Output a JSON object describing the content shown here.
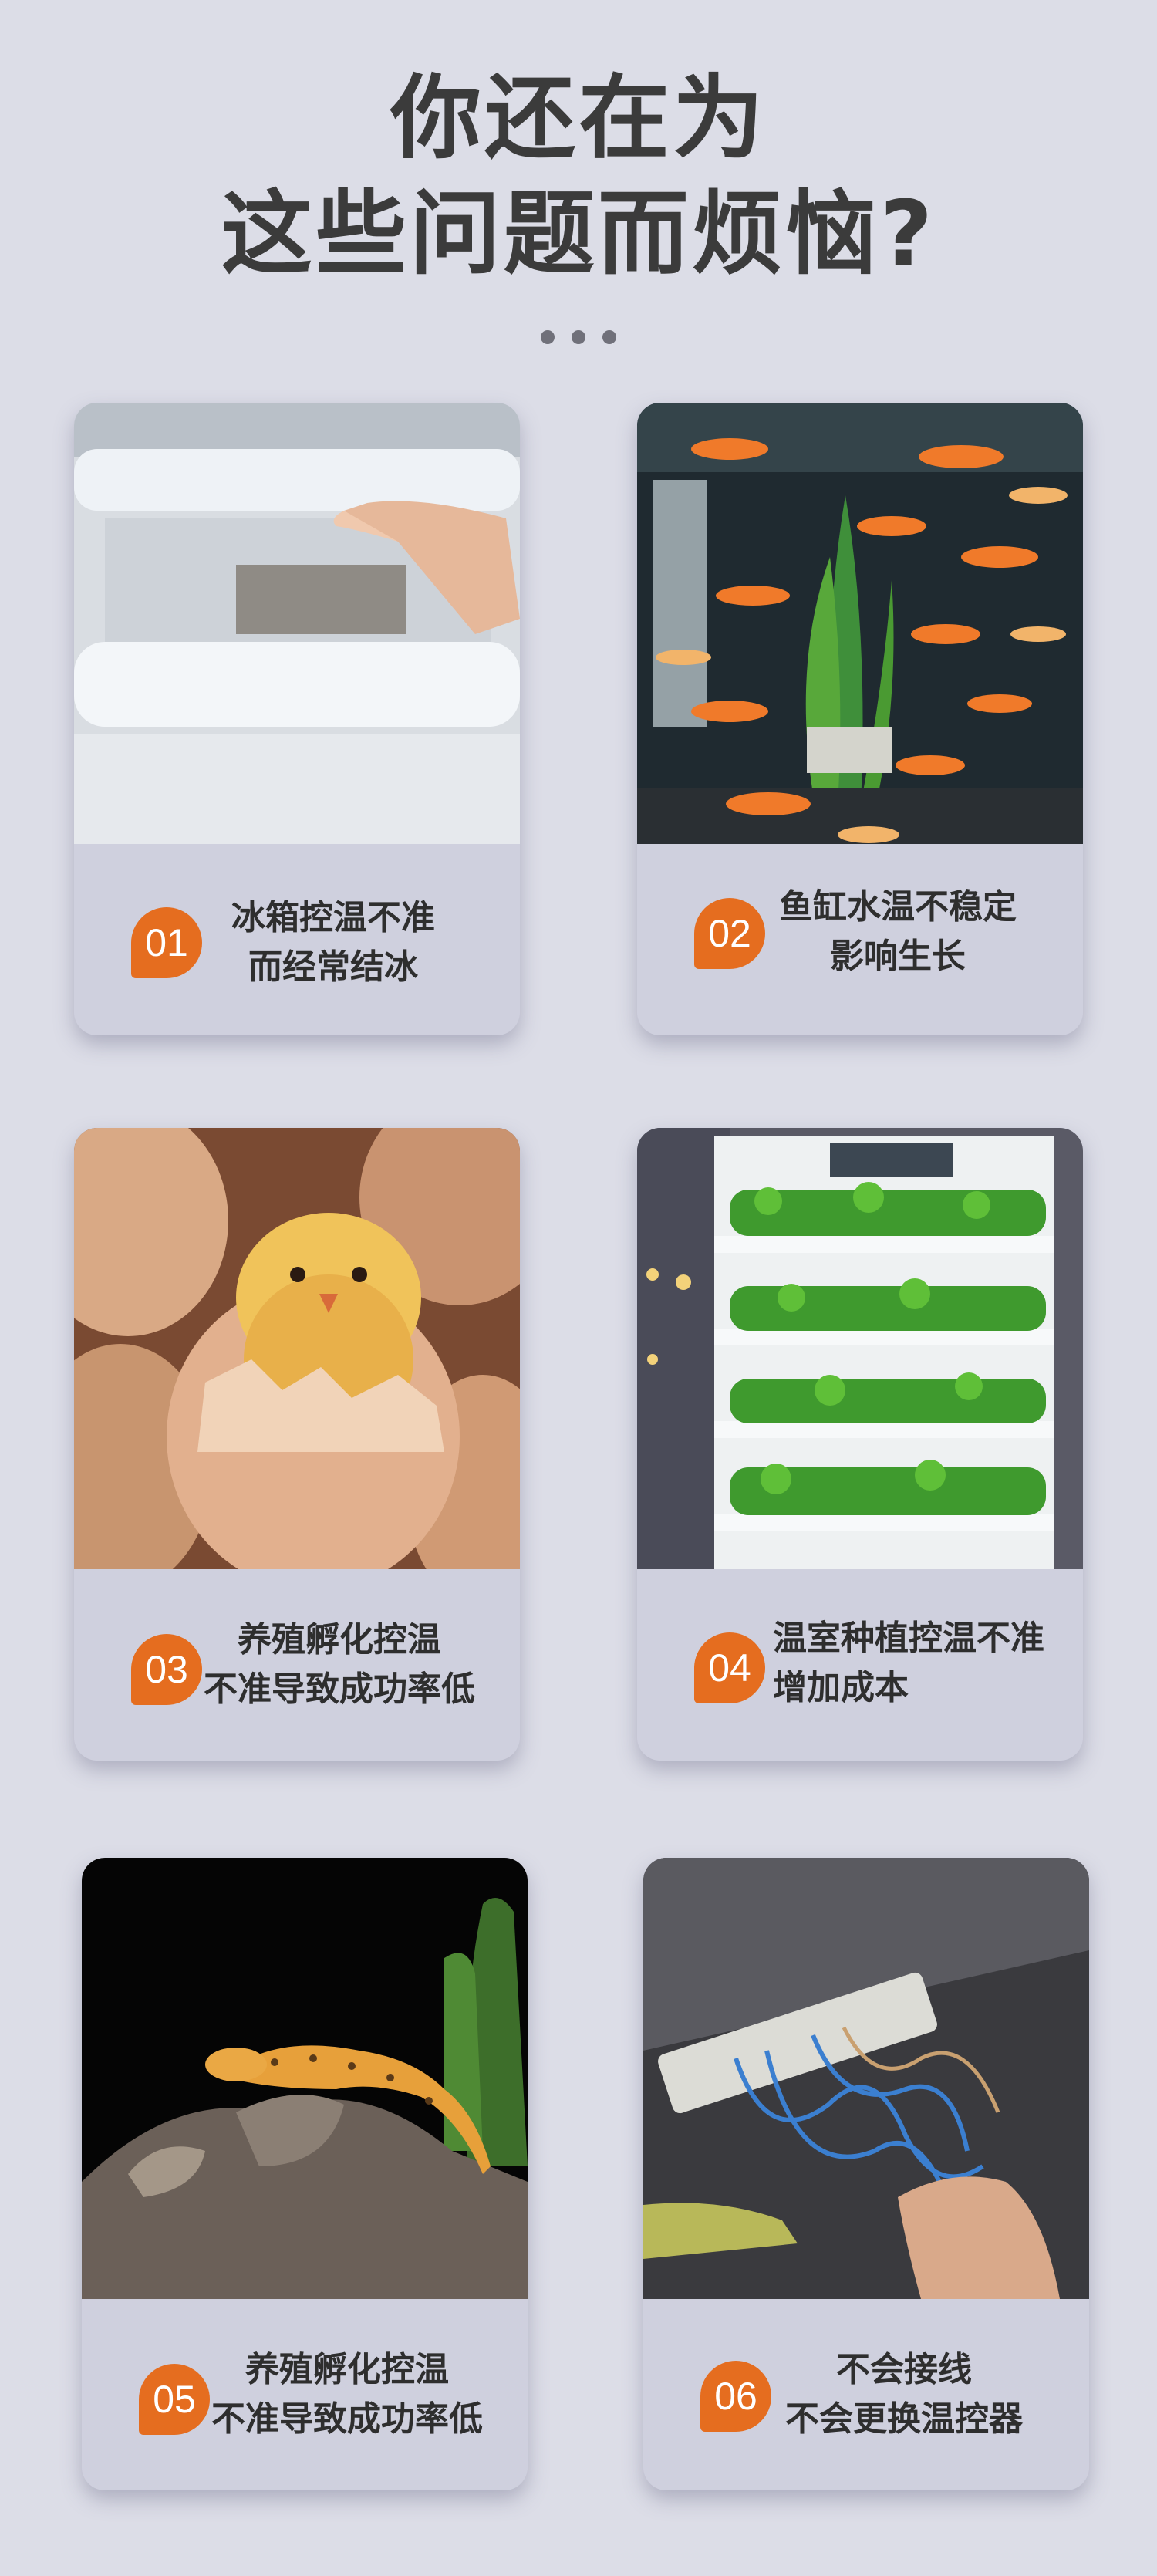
{
  "header": {
    "title_line1": "你还在为",
    "title_line2": "这些问题而烦恼?"
  },
  "pagination": {
    "dots": 3
  },
  "colors": {
    "background": "#dcdde7",
    "card": "#cfd0de",
    "badge": "#e56d1f",
    "text": "#2e2e2e"
  },
  "cards": [
    {
      "number": "01",
      "line1": "冰箱控温不准",
      "line2": "而经常结冰",
      "photo": "frozen-freezer"
    },
    {
      "number": "02",
      "line1": "鱼缸水温不稳定",
      "line2": "影响生长",
      "photo": "aquarium-fish"
    },
    {
      "number": "03",
      "line1": "养殖孵化控温",
      "line2": "不准导致成功率低",
      "photo": "hatching-chick"
    },
    {
      "number": "04",
      "line1": "温室种植控温不准",
      "line2": "增加成本",
      "photo": "indoor-plant-rack"
    },
    {
      "number": "05",
      "line1": "养殖孵化控温",
      "line2": "不准导致成功率低",
      "photo": "gecko-on-rock"
    },
    {
      "number": "06",
      "line1": "不会接线",
      "line2": "不会更换温控器",
      "photo": "wiring-hands"
    }
  ]
}
